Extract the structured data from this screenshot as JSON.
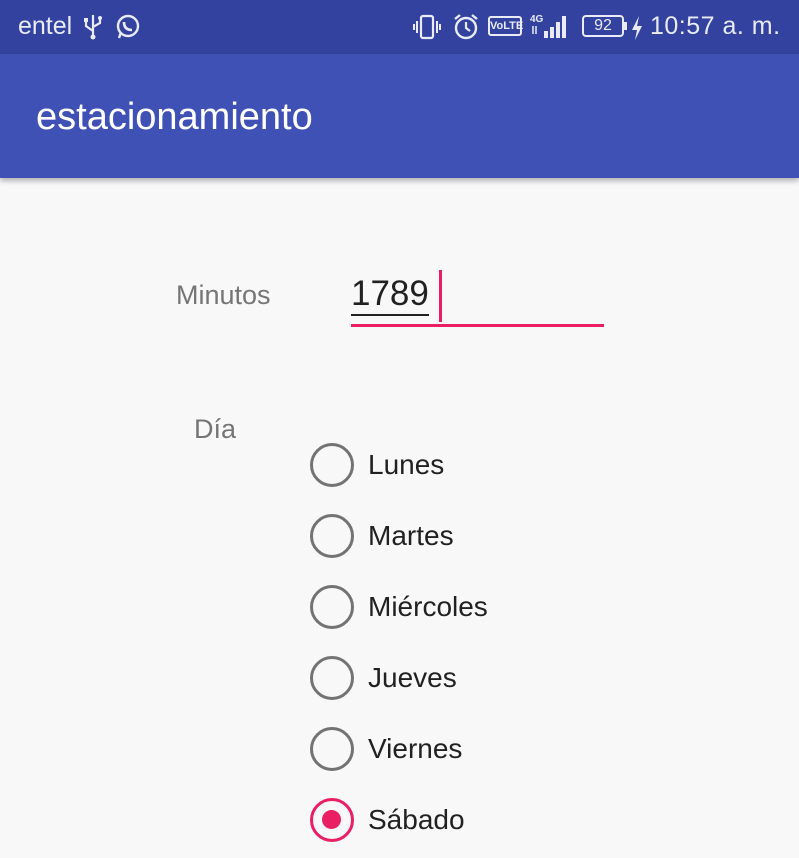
{
  "status_bar": {
    "carrier": "entel",
    "icons": [
      "usb-icon",
      "whatsapp-icon",
      "vibrate-icon",
      "alarm-icon",
      "volte-icon",
      "signal-icon",
      "battery-icon",
      "charging-bolt-icon"
    ],
    "volte": "VoLTE",
    "network": "4G",
    "battery": "92",
    "time": "10:57 a. m."
  },
  "app_bar": {
    "title": "estacionamiento",
    "color": "#3f51b5"
  },
  "form": {
    "minutes_label": "Minutos",
    "minutes_value": "1789",
    "day_label": "Día",
    "accent": "#e91e63",
    "days": [
      {
        "label": "Lunes",
        "checked": false
      },
      {
        "label": "Martes",
        "checked": false
      },
      {
        "label": "Miércoles",
        "checked": false
      },
      {
        "label": "Jueves",
        "checked": false
      },
      {
        "label": "Viernes",
        "checked": false
      },
      {
        "label": "Sábado",
        "checked": true
      }
    ]
  }
}
